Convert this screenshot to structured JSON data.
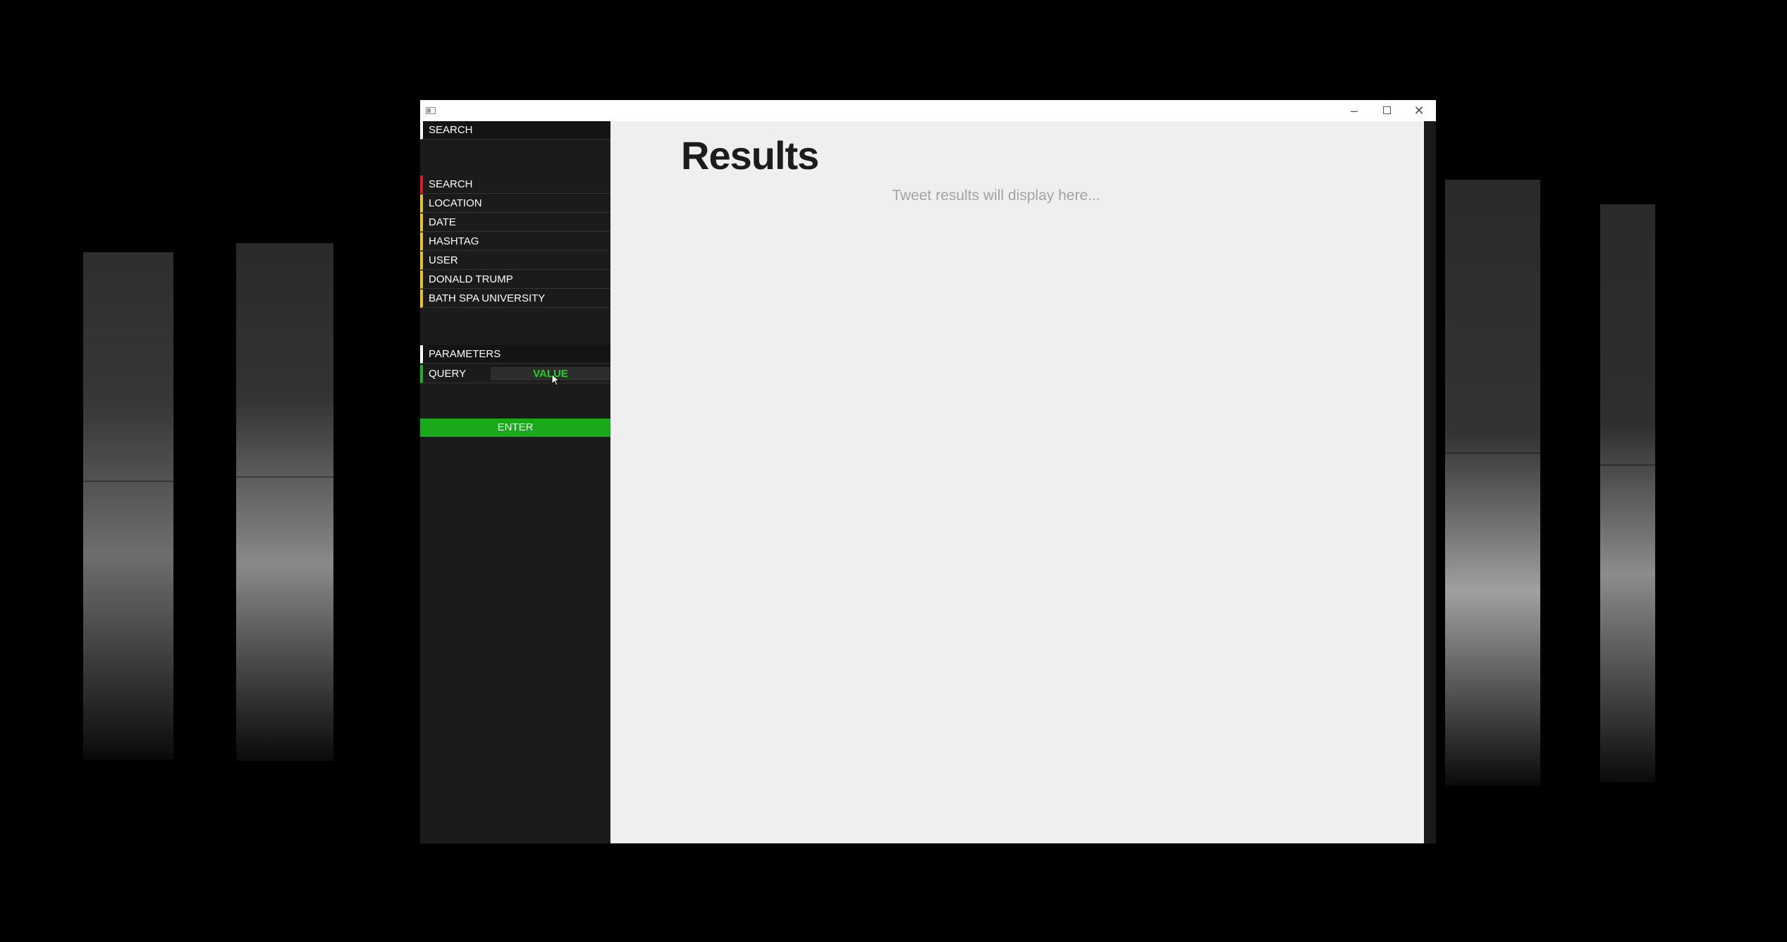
{
  "window": {
    "title": "",
    "controls": {
      "minimize": "–",
      "maximize": "□",
      "close": "✕"
    }
  },
  "sidebar": {
    "search_header": "SEARCH",
    "search_items": [
      {
        "label": "SEARCH",
        "accent": "#d81e1e"
      },
      {
        "label": "LOCATION",
        "accent": "#e8c52a"
      },
      {
        "label": "DATE",
        "accent": "#e8c52a"
      },
      {
        "label": "HASHTAG",
        "accent": "#e8c52a"
      },
      {
        "label": "USER",
        "accent": "#e8c52a"
      },
      {
        "label": "DONALD TRUMP",
        "accent": "#e8c52a"
      },
      {
        "label": "BATH SPA UNIVERSITY",
        "accent": "#e8c52a"
      }
    ],
    "parameters_header": "PARAMETERS",
    "query": {
      "label": "QUERY",
      "value": "VALUE",
      "accent": "#1fb01f"
    },
    "enter_label": "ENTER"
  },
  "main": {
    "title": "Results",
    "placeholder": "Tweet results will display here..."
  },
  "colors": {
    "sidebar_bg": "#1b1b1b",
    "main_bg": "#efefef",
    "enter_button": "#1aa91a",
    "value_text": "#22d022"
  }
}
